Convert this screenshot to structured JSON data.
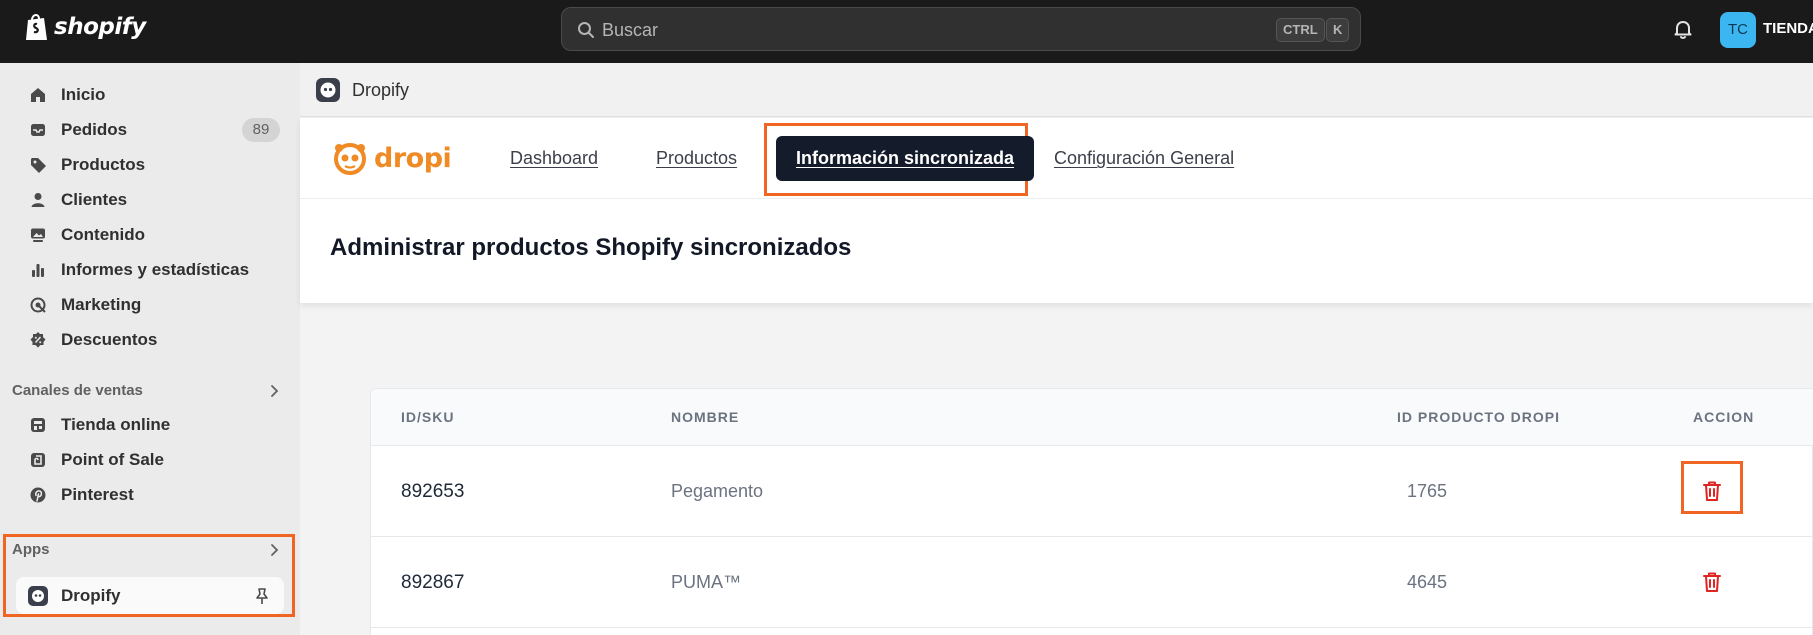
{
  "topbar": {
    "brand": "shopify",
    "search_placeholder": "Buscar",
    "shortcut_ctrl": "CTRL",
    "shortcut_k": "K",
    "avatar_initials": "TC",
    "store_name": "TIENDA"
  },
  "sidebar": {
    "items": [
      {
        "label": "Inicio",
        "icon": "home-icon"
      },
      {
        "label": "Pedidos",
        "icon": "inbox-icon",
        "badge": "89"
      },
      {
        "label": "Productos",
        "icon": "tag-icon"
      },
      {
        "label": "Clientes",
        "icon": "person-icon"
      },
      {
        "label": "Contenido",
        "icon": "image-icon"
      },
      {
        "label": "Informes y estadísticas",
        "icon": "bar-chart-icon"
      },
      {
        "label": "Marketing",
        "icon": "target-icon"
      },
      {
        "label": "Descuentos",
        "icon": "discount-icon"
      }
    ],
    "sales_channels_title": "Canales de ventas",
    "sales_channels": [
      {
        "label": "Tienda online",
        "icon": "store-icon"
      },
      {
        "label": "Point of Sale",
        "icon": "pos-icon"
      },
      {
        "label": "Pinterest",
        "icon": "pinterest-icon"
      }
    ],
    "apps_title": "Apps",
    "apps": [
      {
        "label": "Dropify",
        "icon": "dropify-icon"
      }
    ]
  },
  "app_header": {
    "title": "Dropify"
  },
  "dropi": {
    "logo_text": "dropi",
    "tabs": [
      {
        "label": "Dashboard"
      },
      {
        "label": "Productos"
      },
      {
        "label": "Información sincronizada",
        "active": true
      },
      {
        "label": "Configuración General"
      }
    ],
    "page_title": "Administrar productos Shopify sincronizados"
  },
  "table": {
    "columns": [
      "ID/SKU",
      "NOMBRE",
      "ID PRODUCTO DROPI",
      "ACCION"
    ],
    "rows": [
      {
        "sku": "892653",
        "name": "Pegamento",
        "dropi_id": "1765"
      },
      {
        "sku": "892867",
        "name": "PUMA™",
        "dropi_id": "4645"
      }
    ]
  },
  "colors": {
    "accent_highlight": "#f06522",
    "dropi_orange": "#f08a24",
    "active_tab_bg": "#141b2b",
    "delete_red": "#e02424"
  }
}
